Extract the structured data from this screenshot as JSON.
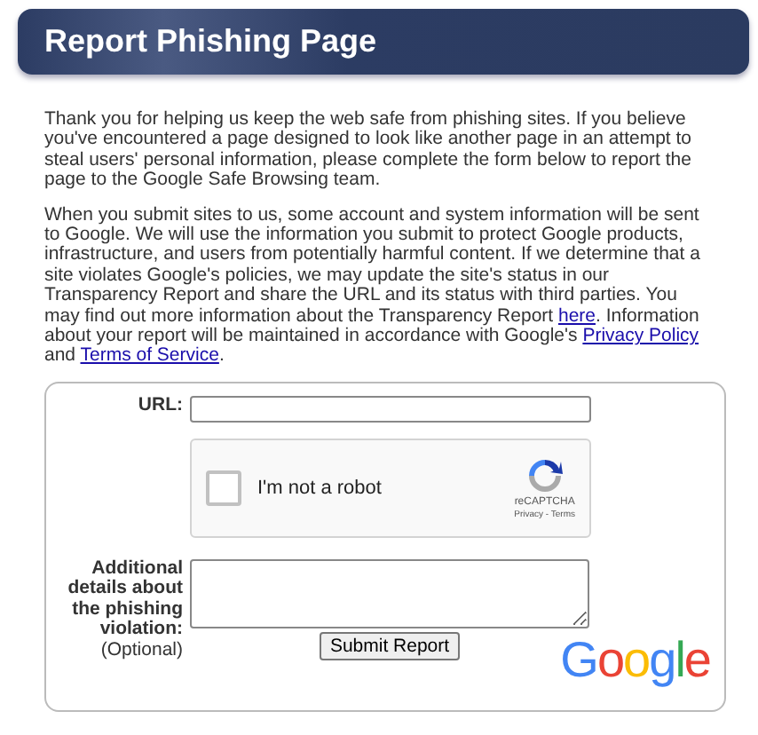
{
  "header": {
    "title": "Report Phishing Page"
  },
  "intro": [
    {
      "parts": [
        {
          "kind": "text",
          "text": "Thank you for helping us keep the web safe from phishing sites. If you believe you've encountered a page designed to look like another page in an attempt to steal users' personal information, please complete the form below to report the page to the Google Safe Browsing team."
        }
      ]
    },
    {
      "parts": [
        {
          "kind": "text",
          "text": "When you submit sites to us, some account and system information will be sent to Google. We will use the information you submit to protect Google products, infrastructure, and users from potentially harmful content. If we determine that a site violates Google's policies, we may update the site's status in our Transparency Report and share the URL and its status with third parties. You may find out more information about the Transparency Report "
        },
        {
          "kind": "link",
          "text": "here"
        },
        {
          "kind": "text",
          "text": ". Information about your report will be maintained in accordance with Google's "
        },
        {
          "kind": "link",
          "text": "Privacy Policy"
        },
        {
          "kind": "text",
          "text": " and "
        },
        {
          "kind": "link",
          "text": "Terms of Service"
        },
        {
          "kind": "text",
          "text": "."
        }
      ]
    }
  ],
  "form": {
    "url_label": "URL:",
    "captcha": {
      "label": "I'm not a robot",
      "checked": false,
      "brand": "reCAPTCHA",
      "links": "Privacy - Terms"
    },
    "details_label": "Additional details about the phishing violation:",
    "details_note": "(Optional)",
    "submit": "Submit Report",
    "logo": "Google"
  }
}
